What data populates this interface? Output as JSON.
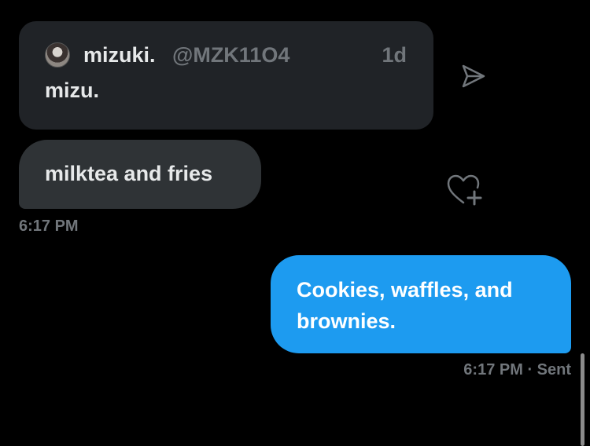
{
  "quoted_post": {
    "author_name": "mizuki.",
    "author_handle": "@MZK11O4",
    "time": "1d",
    "text": "mizu."
  },
  "messages": [
    {
      "direction": "received",
      "text": "milktea and fries",
      "time": "6:17 PM"
    },
    {
      "direction": "sent",
      "text": "Cookies, waffles, and brownies.",
      "time": "6:17 PM",
      "status": "· Sent"
    }
  ],
  "icons": {
    "share": "share-arrow-icon",
    "react": "heart-plus-icon",
    "avatar": "avatar"
  },
  "colors": {
    "background": "#000000",
    "quote_card": "#202327",
    "received_bubble": "#2f3336",
    "sent_bubble": "#1d9bf0",
    "primary_text": "#e7e9ea",
    "secondary_text": "#71767b"
  }
}
